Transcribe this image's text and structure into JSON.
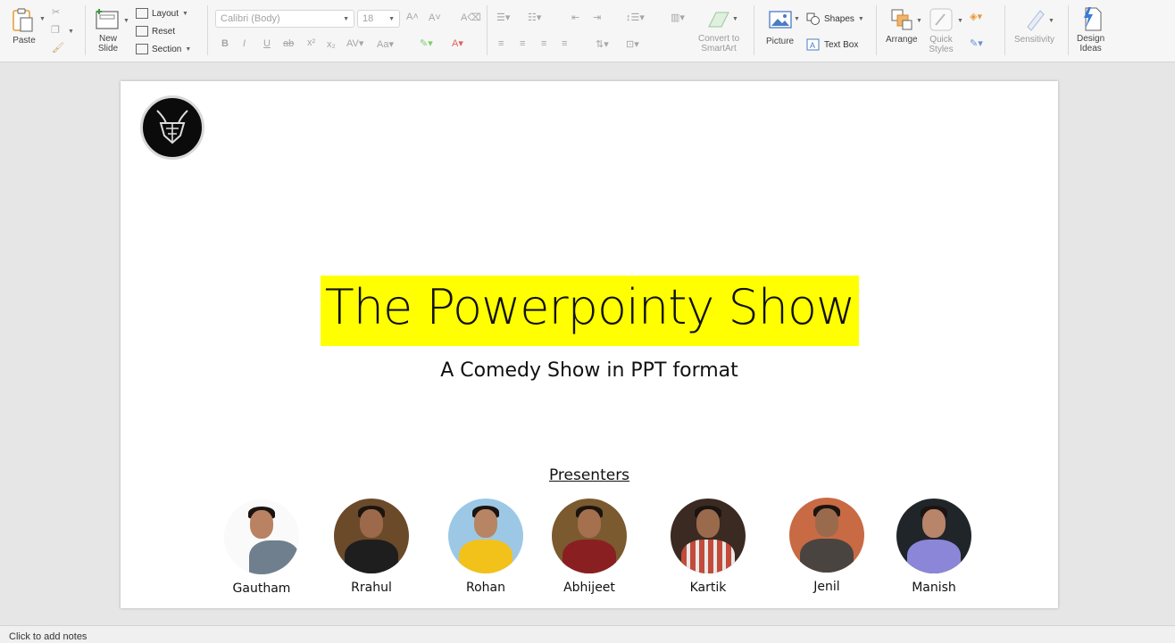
{
  "ribbon": {
    "clipboard": {
      "paste_label": "Paste"
    },
    "slides": {
      "new_slide_label": "New\nSlide",
      "layout_label": "Layout",
      "reset_label": "Reset",
      "section_label": "Section"
    },
    "font": {
      "font_name": "Calibri (Body)",
      "font_size": "18"
    },
    "smartart": {
      "convert_label": "Convert to\nSmartArt"
    },
    "insert": {
      "picture_label": "Picture",
      "shapes_label": "Shapes",
      "textbox_label": "Text Box"
    },
    "drawing": {
      "arrange_label": "Arrange",
      "quick_styles_label": "Quick\nStyles"
    },
    "sensitivity": {
      "label": "Sensitivity"
    },
    "designer": {
      "label": "Design\nIdeas"
    }
  },
  "slide": {
    "title": "The Powerpointy Show",
    "subtitle": "A Comedy Show in PPT format",
    "presenters_heading": "Presenters",
    "presenters": [
      {
        "name": "Gautham"
      },
      {
        "name": "Rrahul"
      },
      {
        "name": "Rohan"
      },
      {
        "name": "Abhijeet"
      },
      {
        "name": "Kartik"
      },
      {
        "name": "Jenil"
      },
      {
        "name": "Manish"
      }
    ]
  },
  "notes": {
    "placeholder": "Click to add notes"
  },
  "colors": {
    "title_highlight": "#ffff00",
    "ribbon_bg": "#f6f6f6",
    "canvas_bg": "#e6e6e6"
  }
}
